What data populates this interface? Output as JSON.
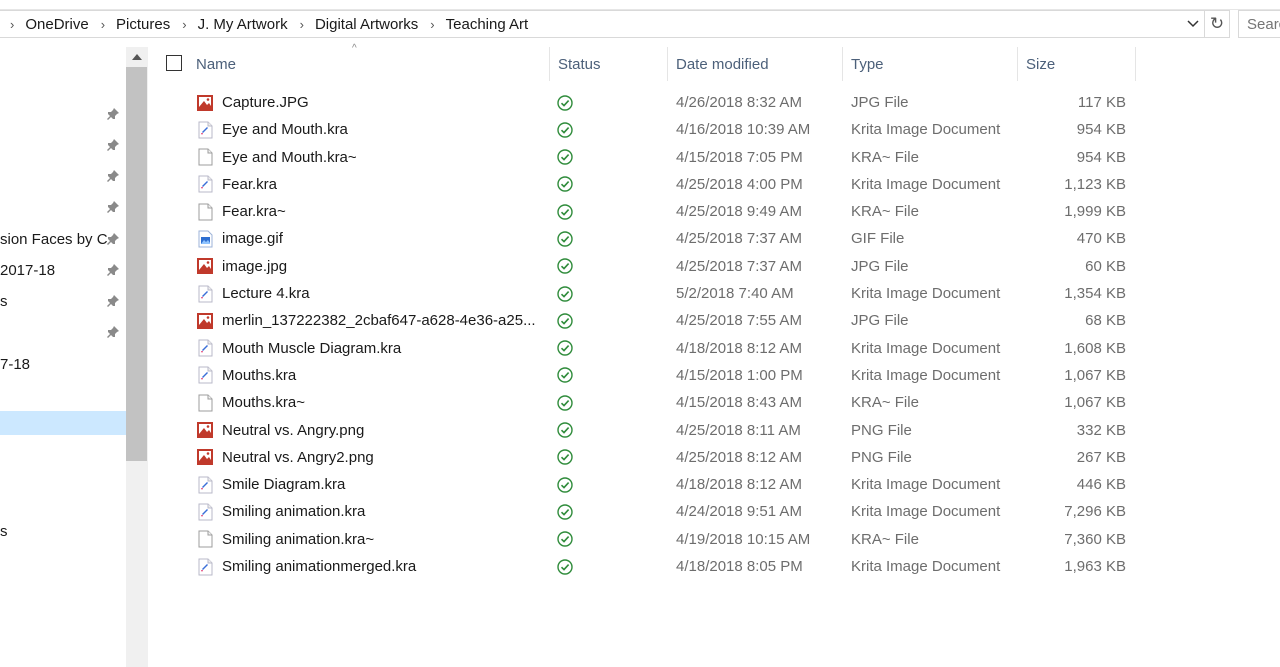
{
  "breadcrumb": [
    "OneDrive",
    "Pictures",
    "J. My Artwork",
    "Digital Artworks",
    "Teaching Art"
  ],
  "search": {
    "placeholder": "Search"
  },
  "nav": {
    "items": [
      {
        "label": "",
        "pinned": true
      },
      {
        "label": "",
        "pinned": true
      },
      {
        "label": "",
        "pinned": true
      },
      {
        "label": "",
        "pinned": true
      },
      {
        "label": "sion Faces by C",
        "pinned": true
      },
      {
        "label": "2017-18",
        "pinned": true
      },
      {
        "label": "s",
        "pinned": true
      },
      {
        "label": "",
        "pinned": true
      },
      {
        "label": "7-18",
        "pinned": false
      },
      {
        "label": "",
        "pinned": false,
        "selected": true
      },
      {
        "label": "s",
        "pinned": false
      }
    ]
  },
  "columns": {
    "name": "Name",
    "status": "Status",
    "date": "Date modified",
    "type": "Type",
    "size": "Size"
  },
  "files": [
    {
      "name": "Capture.JPG",
      "date": "4/26/2018 8:32 AM",
      "type": "JPG File",
      "size": "117 KB",
      "icon": "image-file-icon"
    },
    {
      "name": "Eye and Mouth.kra",
      "date": "4/16/2018 10:39 AM",
      "type": "Krita Image Document",
      "size": "954 KB",
      "icon": "krita-file-icon"
    },
    {
      "name": "Eye and Mouth.kra~",
      "date": "4/15/2018 7:05 PM",
      "type": "KRA~ File",
      "size": "954 KB",
      "icon": "blank-file-icon"
    },
    {
      "name": "Fear.kra",
      "date": "4/25/2018 4:00 PM",
      "type": "Krita Image Document",
      "size": "1,123 KB",
      "icon": "krita-file-icon"
    },
    {
      "name": "Fear.kra~",
      "date": "4/25/2018 9:49 AM",
      "type": "KRA~ File",
      "size": "1,999 KB",
      "icon": "blank-file-icon"
    },
    {
      "name": "image.gif",
      "date": "4/25/2018 7:37 AM",
      "type": "GIF File",
      "size": "470 KB",
      "icon": "gif-file-icon"
    },
    {
      "name": "image.jpg",
      "date": "4/25/2018 7:37 AM",
      "type": "JPG File",
      "size": "60 KB",
      "icon": "image-file-icon"
    },
    {
      "name": "Lecture 4.kra",
      "date": "5/2/2018 7:40 AM",
      "type": "Krita Image Document",
      "size": "1,354 KB",
      "icon": "krita-file-icon"
    },
    {
      "name": "merlin_137222382_2cbaf647-a628-4e36-a25...",
      "date": "4/25/2018 7:55 AM",
      "type": "JPG File",
      "size": "68 KB",
      "icon": "image-file-icon"
    },
    {
      "name": "Mouth Muscle Diagram.kra",
      "date": "4/18/2018 8:12 AM",
      "type": "Krita Image Document",
      "size": "1,608 KB",
      "icon": "krita-file-icon"
    },
    {
      "name": "Mouths.kra",
      "date": "4/15/2018 1:00 PM",
      "type": "Krita Image Document",
      "size": "1,067 KB",
      "icon": "krita-file-icon"
    },
    {
      "name": "Mouths.kra~",
      "date": "4/15/2018 8:43 AM",
      "type": "KRA~ File",
      "size": "1,067 KB",
      "icon": "blank-file-icon"
    },
    {
      "name": "Neutral vs. Angry.png",
      "date": "4/25/2018 8:11 AM",
      "type": "PNG File",
      "size": "332 KB",
      "icon": "image-file-icon"
    },
    {
      "name": "Neutral vs. Angry2.png",
      "date": "4/25/2018 8:12 AM",
      "type": "PNG File",
      "size": "267 KB",
      "icon": "image-file-icon"
    },
    {
      "name": "Smile Diagram.kra",
      "date": "4/18/2018 8:12 AM",
      "type": "Krita Image Document",
      "size": "446 KB",
      "icon": "krita-file-icon"
    },
    {
      "name": "Smiling animation.kra",
      "date": "4/24/2018 9:51 AM",
      "type": "Krita Image Document",
      "size": "7,296 KB",
      "icon": "krita-file-icon"
    },
    {
      "name": "Smiling animation.kra~",
      "date": "4/19/2018 10:15 AM",
      "type": "KRA~ File",
      "size": "7,360 KB",
      "icon": "blank-file-icon"
    },
    {
      "name": "Smiling animationmerged.kra",
      "date": "4/18/2018 8:05 PM",
      "type": "Krita Image Document",
      "size": "1,963 KB",
      "icon": "krita-file-icon"
    }
  ],
  "colors": {
    "selection": "#cce8ff",
    "header_text": "#4c607a",
    "sync_green": "#2e8b3a"
  }
}
